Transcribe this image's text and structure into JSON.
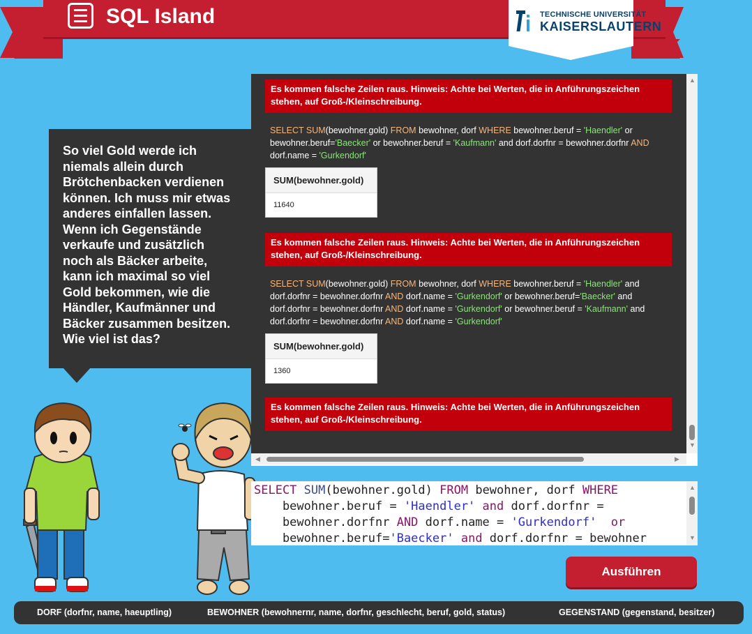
{
  "header": {
    "title": "SQL Island",
    "university_line1": "TECHNISCHE UNIVERSITÄT",
    "university_line2": "KAISERSLAUTERN"
  },
  "colors": {
    "background": "#4fbcef",
    "banner": "#c41f31",
    "panel": "#333333",
    "error": "#c2000b",
    "keyword": "#f6b77c",
    "string": "#8fe37e"
  },
  "story": {
    "text": "So viel Gold werde ich niemals allein durch Brötchenbacken verdienen können. Ich muss mir etwas anderes einfallen lassen. Wenn ich Gegenstände verkaufe und zusätzlich noch als Bäcker arbeite, kann ich maximal so viel Gold bekommen, wie die Händler, Kaufmänner und Bäcker zusammen besitzen. Wie viel ist das?"
  },
  "results": {
    "error_message": "Es kommen falsche Zeilen raus. Hinweis: Achte bei Werten, die in Anführungszeichen stehen, auf Groß-/Kleinschreibung.",
    "queries": [
      {
        "p1": "SELECT SUM",
        "p2": "(bewohner.gold) ",
        "p3": "FROM",
        "p4": " bewohner, dorf ",
        "p5": "WHERE",
        "p6": " bewohner.beruf = ",
        "p7": "'Haendler'",
        "p8": " or bewohner.beruf=",
        "p9": "'Baecker'",
        "p10": " or bewohner.beruf = ",
        "p11": "'Kaufmann'",
        "p12": " and dorf.dorfnr = bewohner.dorfnr ",
        "p13": "AND",
        "p14": " dorf.name = ",
        "p15": "'Gurkendorf'",
        "column": "SUM(bewohner.gold)",
        "value": "11640"
      },
      {
        "p1": "SELECT SUM",
        "p2": "(bewohner.gold) ",
        "p3": "FROM",
        "p4": " bewohner, dorf ",
        "p5": "WHERE",
        "p6": " bewohner.beruf = ",
        "p7": "'Haendler'",
        "p8": " and dorf.dorfnr = bewohner.dorfnr ",
        "p9": "AND",
        "p10": " dorf.name = ",
        "p11": "'Gurkendorf'",
        "p12": "  or bewohner.beruf=",
        "p13": "'Baecker'",
        "p14": " and dorf.dorfnr = bewohner.dorfnr ",
        "p15": "AND",
        "p16": " dorf.name = ",
        "p17": "'Gurkendorf'",
        "p18": "  or bewohner.beruf = ",
        "p19": "'Kaufmann'",
        "p20": " and dorf.dorfnr = bewohner.dorfnr ",
        "p21": "AND",
        "p22": " dorf.name = ",
        "p23": "'Gurkendorf'",
        "column": "SUM(bewohner.gold)",
        "value": "1360"
      }
    ]
  },
  "editor": {
    "l1a": "SELECT ",
    "l1b": "SUM",
    "l1c": "(bewohner.gold) ",
    "l1d": "FROM",
    "l1e": " bewohner, dorf ",
    "l1f": "WHERE",
    "l2a": "    bewohner.beruf = ",
    "l2b": "'Haendler'",
    "l2c": " ",
    "l2d": "and",
    "l2e": " dorf.dorfnr =",
    "l3a": "    bewohner.dorfnr ",
    "l3b": "AND",
    "l3c": " dorf.name = ",
    "l3d": "'Gurkendorf'",
    "l3e": "  ",
    "l3f": "or",
    "l4a": "    bewohner.beruf=",
    "l4b": "'Baecker'",
    "l4c": " ",
    "l4d": "and",
    "l4e": " dorf.dorfnr = bewohner"
  },
  "run_button": "Ausführen",
  "schema": {
    "dorf": "DORF (dorfnr, name, haeuptling)",
    "bewohner": "BEWOHNER (bewohnernr, name, dorfnr, geschlecht, beruf, gold, status)",
    "gegenstand": "GEGENSTAND (gegenstand, besitzer)"
  }
}
